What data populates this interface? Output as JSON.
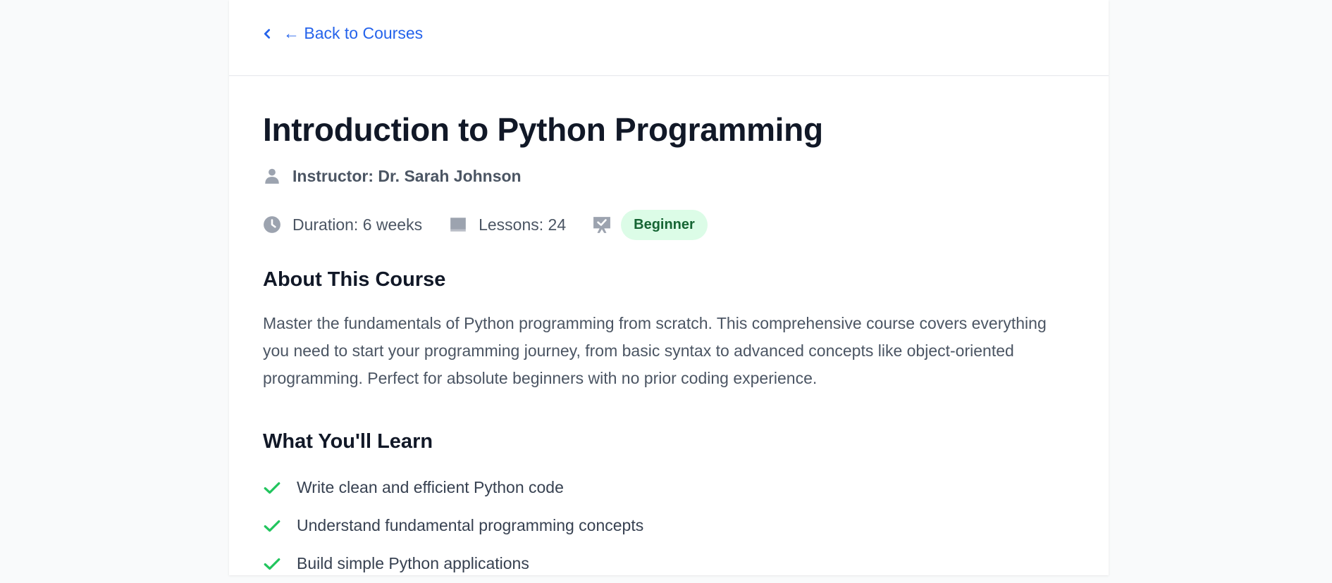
{
  "nav": {
    "back_label": "← Back to Courses"
  },
  "course": {
    "title": "Introduction to Python Programming",
    "instructor": "Instructor: Dr. Sarah Johnson",
    "duration": "Duration: 6 weeks",
    "lessons": "Lessons: 24",
    "level": "Beginner"
  },
  "about": {
    "heading": "About This Course",
    "text": "Master the fundamentals of Python programming from scratch. This comprehensive course covers everything you need to start your programming journey, from basic syntax to advanced concepts like object-oriented programming. Perfect for absolute beginners with no prior coding experience."
  },
  "learn": {
    "heading": "What You'll Learn",
    "items": [
      {
        "text": "Write clean and efficient Python code"
      },
      {
        "text": "Understand fundamental programming concepts"
      },
      {
        "text": "Build simple Python applications"
      }
    ]
  },
  "icons": {
    "back": "chevron-left-icon",
    "instructor": "user-icon",
    "duration": "clock-icon",
    "lessons": "book-icon",
    "level": "badge-check-icon",
    "learn_item": "check-icon"
  },
  "colors": {
    "accent": "#2563eb",
    "badge_bg": "#dcfce7",
    "badge_text": "#166534",
    "check": "#22c55e",
    "icon_gray": "#9ca3af"
  }
}
